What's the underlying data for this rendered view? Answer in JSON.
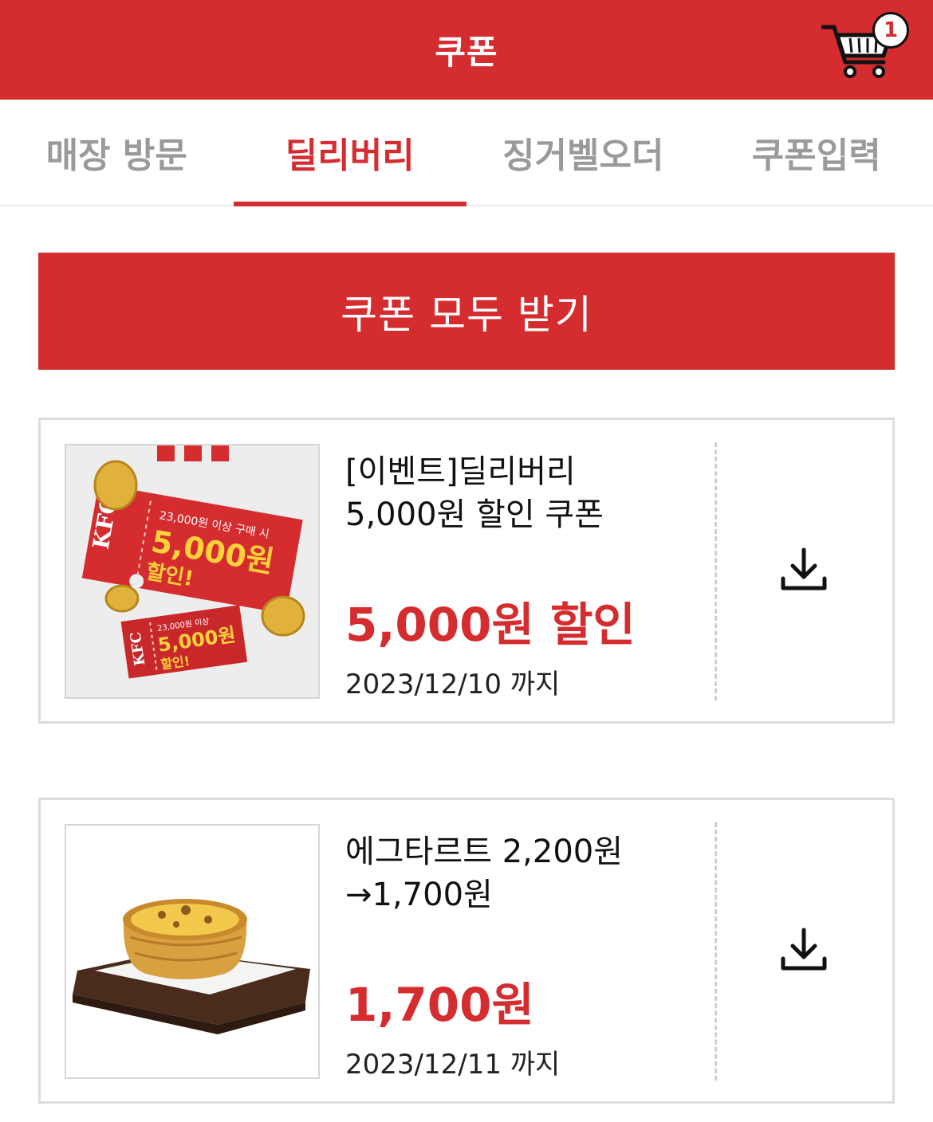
{
  "header": {
    "title": "쿠폰",
    "cart_count": "1"
  },
  "tabs": [
    {
      "label": "매장 방문",
      "active": false
    },
    {
      "label": "딜리버리",
      "active": true
    },
    {
      "label": "징거벨오더",
      "active": false
    },
    {
      "label": "쿠폰입력",
      "active": false
    }
  ],
  "get_all_label": "쿠폰 모두 받기",
  "coupons": [
    {
      "title_line1": "[이벤트]딜리버리",
      "title_line2": "5,000원 할인 쿠폰",
      "price": "5,000원 할인",
      "expiry": "2023/12/10 까지",
      "image": {
        "brand": "KFC",
        "big_ticket_caption": "23,000원 이상 구매 시",
        "big_ticket_amount": "5,000원",
        "big_ticket_discount": "할인!",
        "small_ticket_caption": "23,000원 이상",
        "small_ticket_amount": "5,000원",
        "small_ticket_discount": "할인!"
      }
    },
    {
      "title_line1": "에그타르트 2,200원",
      "title_line2": "→1,700원",
      "price": "1,700원",
      "expiry": "2023/12/11 까지"
    }
  ],
  "colors": {
    "brand_red": "#d42c2f",
    "gold": "#e0b23c"
  },
  "icons": {
    "cart": "cart-icon",
    "download": "download-icon"
  }
}
